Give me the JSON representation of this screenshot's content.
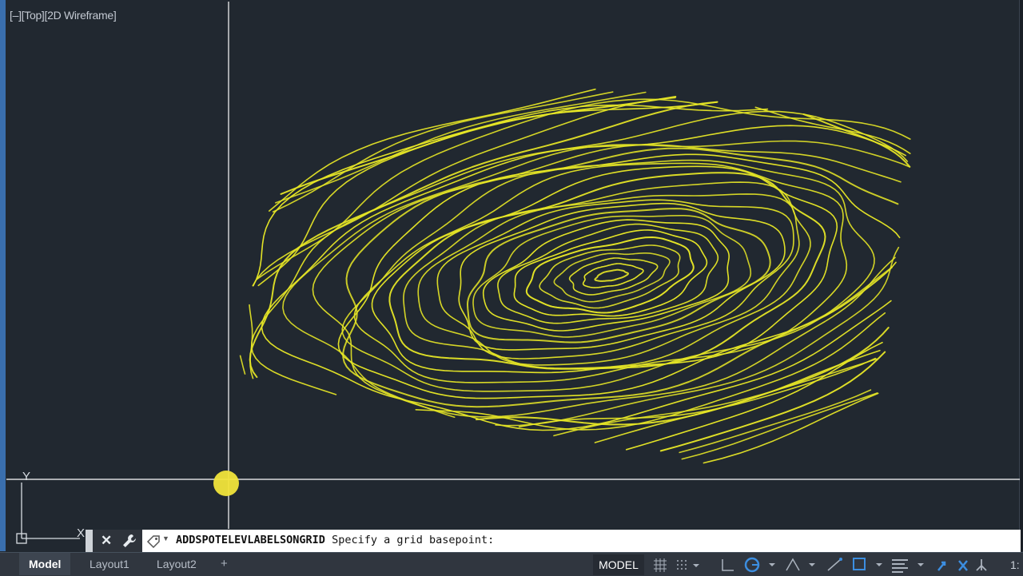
{
  "viewport": {
    "label": "[–][Top][2D Wireframe]",
    "background": "#212830",
    "contour_color": "#e6e626",
    "crosshair_color": "#ffffff",
    "ucs_icon": "ucs-axis-icon",
    "ucs_y_label": "Y",
    "ucs_x_label": "X"
  },
  "command_line": {
    "command": "ADDSPOTELEVLABELSONGRID",
    "prompt": " Specify a grid basepoint:",
    "close_icon": "close-icon",
    "customize_icon": "wrench-icon",
    "recent_icon": "recent-commands-icon"
  },
  "layout_tabs": [
    {
      "label": "Model",
      "active": true
    },
    {
      "label": "Layout1",
      "active": false
    },
    {
      "label": "Layout2",
      "active": false
    }
  ],
  "add_tab_label": "+",
  "status_bar": {
    "model_label": "MODEL",
    "icons": [
      "grid-display-icon",
      "snap-mode-icon",
      "ortho-icon",
      "polar-tracking-icon",
      "isodraft-icon",
      "object-snap-tracking-icon",
      "object-snap-icon",
      "annotation-scale-icon",
      "customization-icon"
    ],
    "scale_fragment": "1:"
  }
}
